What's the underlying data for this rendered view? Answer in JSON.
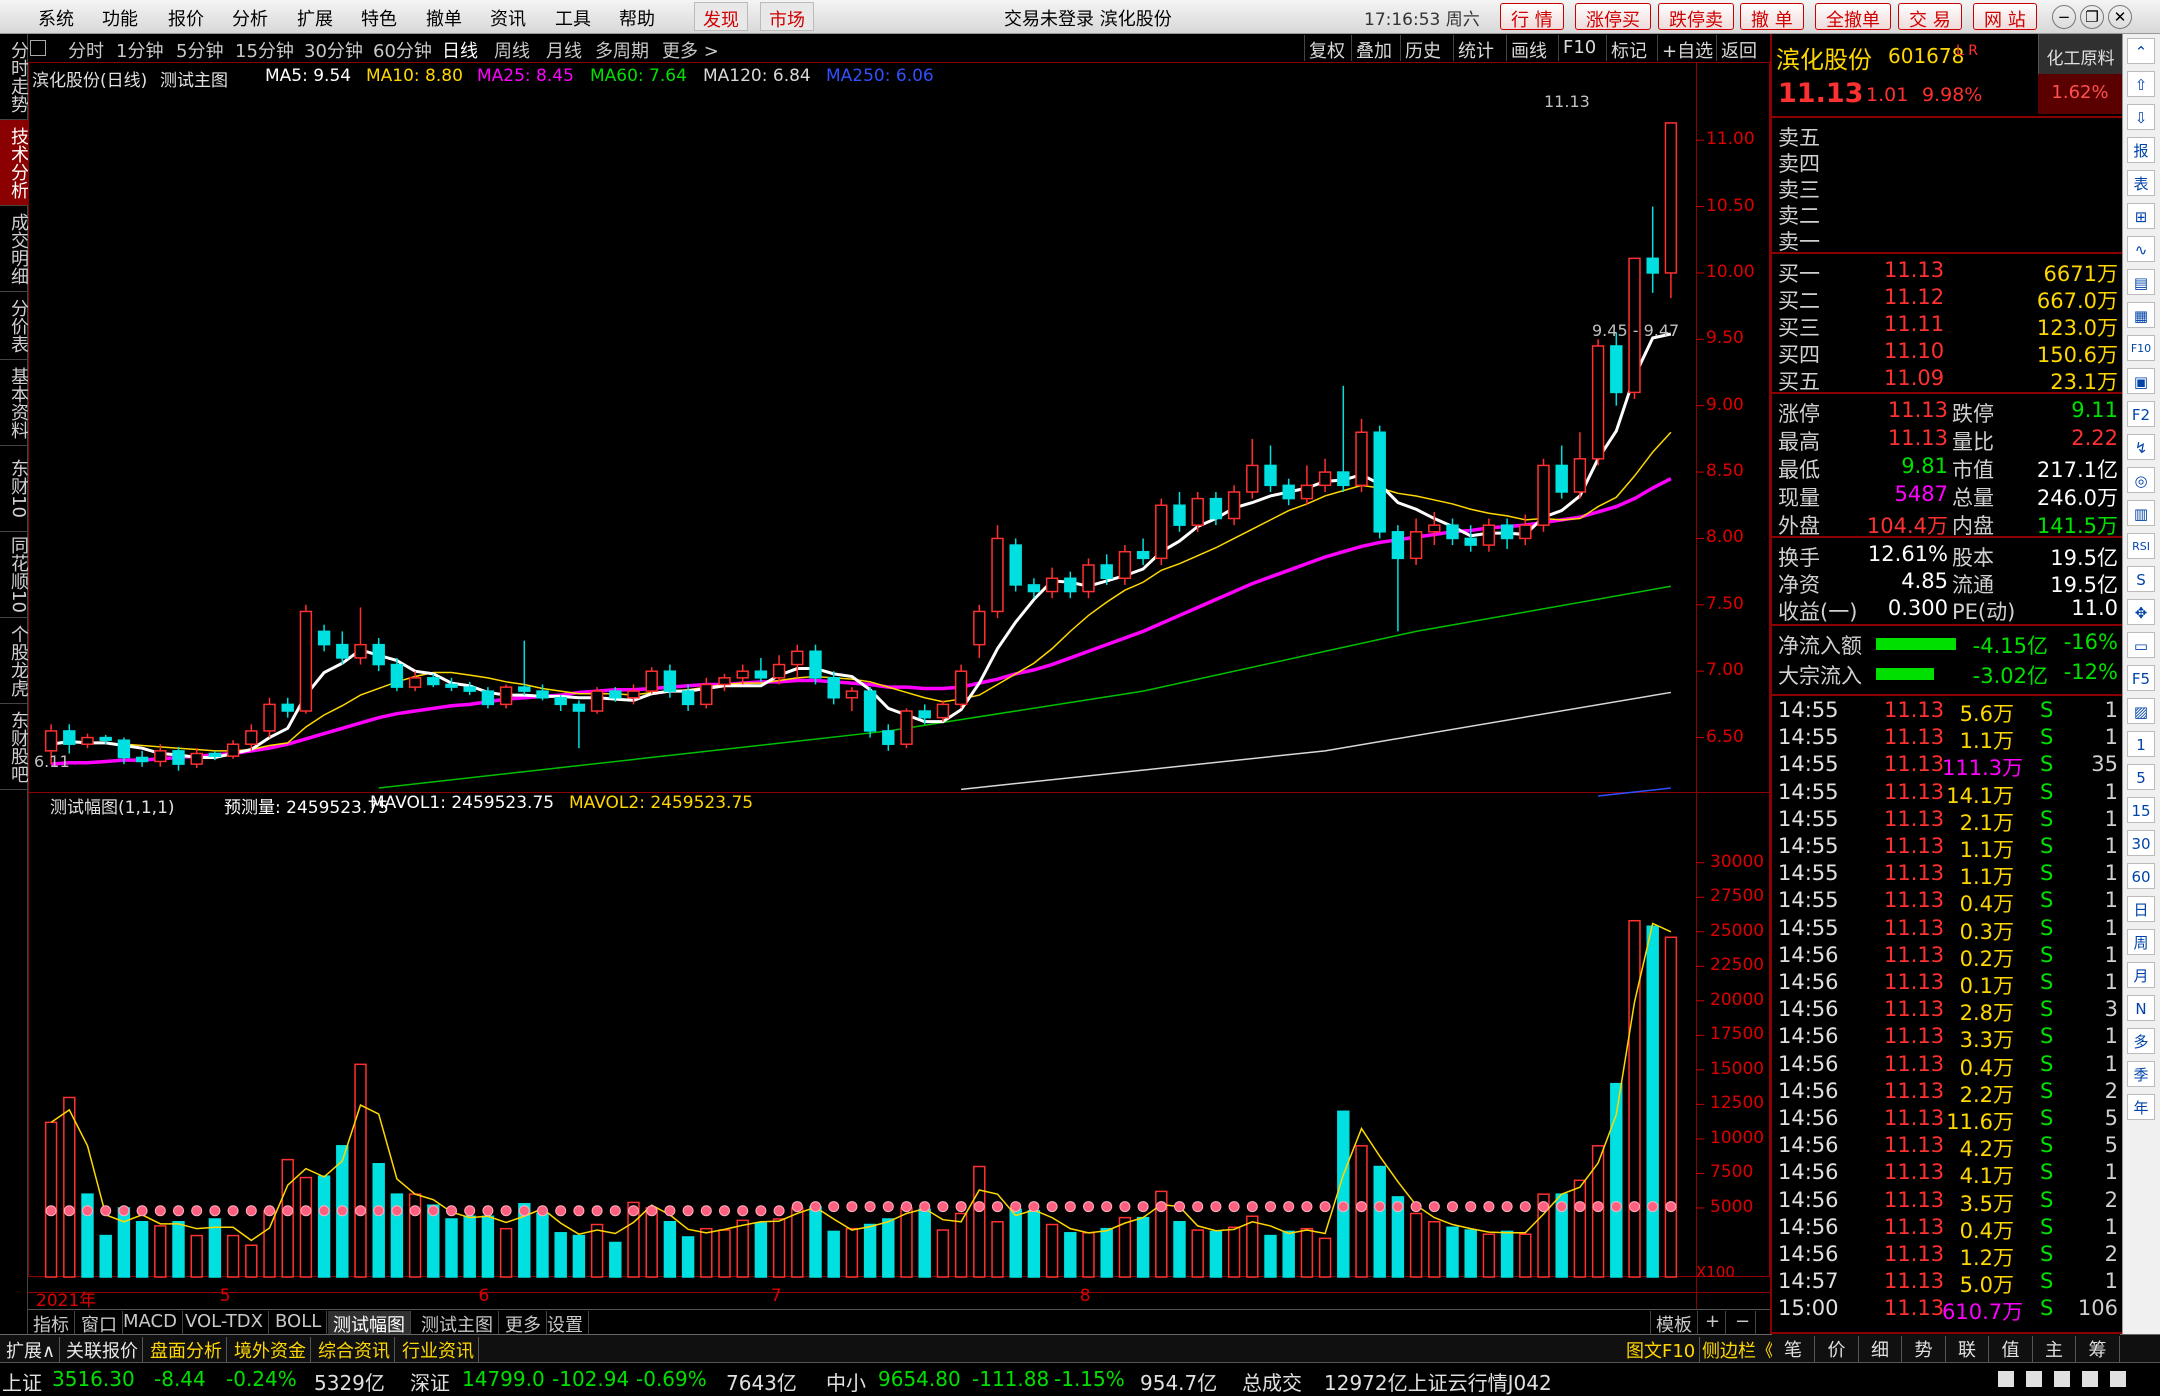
{
  "menu": {
    "items": [
      "系统",
      "功能",
      "报价",
      "分析",
      "扩展",
      "特色",
      "撤单",
      "资讯",
      "工具",
      "帮助"
    ],
    "highlight": [
      "发现",
      "市场"
    ],
    "title_text": "交易未登录  滨化股份",
    "clock": "17:16:53 周六",
    "quick_buttons": [
      "行 情",
      "涨停买",
      "跌停卖",
      "撤 单",
      "全撤单",
      "交 易",
      "网 站"
    ]
  },
  "left_tabs": [
    "分时走势",
    "技术分析",
    "成交明细",
    "分价表",
    "基本资料",
    "东财10",
    "同花顺10",
    "个股龙虎",
    "东财股吧"
  ],
  "left_tab_active": 1,
  "periods": [
    "分时",
    "1分钟",
    "5分钟",
    "15分钟",
    "30分钟",
    "60分钟",
    "日线",
    "周线",
    "月线",
    "多周期",
    "更多 >"
  ],
  "period_active": "日线",
  "chart_tools": [
    "复权",
    "叠加",
    "历史",
    "统计",
    "画线",
    "F10",
    "标记",
    "+自选",
    "返回"
  ],
  "main_indicator": {
    "title": "滨化股份(日线)",
    "formula": "测试主图",
    "ma5": "MA5: 9.54",
    "ma10": "MA10: 8.80",
    "ma25": "MA25: 8.45",
    "ma60": "MA60: 7.64",
    "ma120": "MA120: 6.84",
    "ma250": "MA250: 6.06"
  },
  "sub_indicator": {
    "title": "测试幅图(1,1,1)",
    "pred": "预测量: 2459523.75",
    "mavol1": "MAVOL1: 2459523.75",
    "mavol2": "MAVOL2: 2459523.75",
    "scale": "X100"
  },
  "chart_data": {
    "type": "candlestick",
    "price_axis": [
      "11.00",
      "10.50",
      "10.00",
      "9.50",
      "9.00",
      "8.50",
      "8.00",
      "7.50",
      "7.00",
      "6.50"
    ],
    "volume_axis": [
      "30000",
      "27500",
      "25000",
      "22500",
      "20000",
      "17500",
      "15000",
      "12500",
      "10000",
      "7500",
      "5000"
    ],
    "x_labels": [
      "2021年",
      "5",
      "6",
      "7",
      "8"
    ],
    "annot_high": "11.13",
    "annot_range": "9.45 - 9.47",
    "annot_low": "6.11",
    "candles": [
      [
        6.4,
        6.55,
        6.3,
        6.6
      ],
      [
        6.55,
        6.45,
        6.38,
        6.6
      ],
      [
        6.45,
        6.5,
        6.42,
        6.53
      ],
      [
        6.5,
        6.48,
        6.45,
        6.52
      ],
      [
        6.48,
        6.35,
        6.3,
        6.5
      ],
      [
        6.35,
        6.32,
        6.28,
        6.4
      ],
      [
        6.32,
        6.4,
        6.28,
        6.45
      ],
      [
        6.4,
        6.3,
        6.25,
        6.43
      ],
      [
        6.3,
        6.38,
        6.27,
        6.42
      ],
      [
        6.38,
        6.36,
        6.33,
        6.4
      ],
      [
        6.36,
        6.45,
        6.34,
        6.48
      ],
      [
        6.45,
        6.55,
        6.4,
        6.6
      ],
      [
        6.55,
        6.75,
        6.5,
        6.8
      ],
      [
        6.75,
        6.7,
        6.65,
        6.8
      ],
      [
        6.7,
        7.45,
        6.68,
        7.5
      ],
      [
        7.3,
        7.2,
        7.15,
        7.35
      ],
      [
        7.2,
        7.1,
        7.05,
        7.3
      ],
      [
        7.1,
        7.2,
        7.05,
        7.48
      ],
      [
        7.2,
        7.05,
        7.0,
        7.25
      ],
      [
        7.05,
        6.88,
        6.85,
        7.1
      ],
      [
        6.88,
        6.95,
        6.85,
        7.0
      ],
      [
        6.95,
        6.9,
        6.88,
        6.98
      ],
      [
        6.9,
        6.88,
        6.85,
        6.95
      ],
      [
        6.88,
        6.85,
        6.82,
        6.92
      ],
      [
        6.85,
        6.75,
        6.72,
        6.88
      ],
      [
        6.75,
        6.88,
        6.72,
        6.9
      ],
      [
        6.88,
        6.85,
        6.82,
        7.23
      ],
      [
        6.85,
        6.8,
        6.78,
        6.9
      ],
      [
        6.8,
        6.75,
        6.7,
        6.82
      ],
      [
        6.75,
        6.7,
        6.42,
        6.78
      ],
      [
        6.7,
        6.85,
        6.68,
        6.88
      ],
      [
        6.85,
        6.8,
        6.77,
        6.88
      ],
      [
        6.8,
        6.85,
        6.75,
        6.9
      ],
      [
        6.85,
        7.0,
        6.83,
        7.03
      ],
      [
        7.0,
        6.85,
        6.8,
        7.05
      ],
      [
        6.85,
        6.75,
        6.7,
        6.9
      ],
      [
        6.75,
        6.9,
        6.72,
        6.95
      ],
      [
        6.9,
        6.95,
        6.85,
        6.98
      ],
      [
        6.95,
        7.0,
        6.9,
        7.05
      ],
      [
        7.0,
        6.95,
        6.92,
        7.1
      ],
      [
        6.95,
        7.05,
        6.9,
        7.12
      ],
      [
        7.05,
        7.15,
        6.95,
        7.2
      ],
      [
        7.15,
        6.95,
        6.9,
        7.2
      ],
      [
        6.95,
        6.8,
        6.75,
        7.0
      ],
      [
        6.8,
        6.85,
        6.7,
        6.88
      ],
      [
        6.85,
        6.55,
        6.5,
        6.88
      ],
      [
        6.55,
        6.45,
        6.4,
        6.6
      ],
      [
        6.45,
        6.7,
        6.42,
        6.72
      ],
      [
        6.7,
        6.65,
        6.6,
        6.75
      ],
      [
        6.65,
        6.75,
        6.62,
        6.78
      ],
      [
        6.75,
        7.0,
        6.72,
        7.05
      ],
      [
        7.2,
        7.45,
        7.1,
        7.5
      ],
      [
        7.45,
        8.0,
        7.4,
        8.1
      ],
      [
        7.95,
        7.65,
        7.6,
        8.0
      ],
      [
        7.65,
        7.6,
        7.55,
        7.7
      ],
      [
        7.6,
        7.7,
        7.55,
        7.78
      ],
      [
        7.7,
        7.6,
        7.55,
        7.75
      ],
      [
        7.6,
        7.8,
        7.55,
        7.85
      ],
      [
        7.8,
        7.7,
        7.65,
        7.88
      ],
      [
        7.7,
        7.9,
        7.65,
        7.95
      ],
      [
        7.9,
        7.85,
        7.8,
        8.0
      ],
      [
        7.85,
        8.25,
        7.8,
        8.3
      ],
      [
        8.25,
        8.1,
        8.05,
        8.35
      ],
      [
        8.1,
        8.3,
        8.05,
        8.35
      ],
      [
        8.3,
        8.15,
        8.1,
        8.35
      ],
      [
        8.15,
        8.35,
        8.1,
        8.4
      ],
      [
        8.35,
        8.55,
        8.3,
        8.75
      ],
      [
        8.55,
        8.4,
        8.35,
        8.7
      ],
      [
        8.4,
        8.3,
        8.25,
        8.45
      ],
      [
        8.3,
        8.4,
        8.25,
        8.55
      ],
      [
        8.4,
        8.5,
        8.35,
        8.6
      ],
      [
        8.5,
        8.4,
        8.35,
        9.15
      ],
      [
        8.4,
        8.8,
        8.35,
        8.9
      ],
      [
        8.8,
        8.05,
        8.0,
        8.85
      ],
      [
        8.05,
        7.85,
        7.3,
        8.1
      ],
      [
        7.85,
        8.05,
        7.8,
        8.15
      ],
      [
        8.05,
        8.1,
        7.95,
        8.2
      ],
      [
        8.1,
        8.0,
        7.95,
        8.15
      ],
      [
        8.0,
        7.95,
        7.9,
        8.1
      ],
      [
        7.95,
        8.1,
        7.9,
        8.15
      ],
      [
        8.1,
        8.0,
        7.92,
        8.15
      ],
      [
        8.0,
        8.1,
        7.95,
        8.18
      ],
      [
        8.1,
        8.55,
        8.05,
        8.6
      ],
      [
        8.55,
        8.35,
        8.3,
        8.7
      ],
      [
        8.35,
        8.6,
        8.3,
        8.8
      ],
      [
        8.6,
        9.45,
        8.55,
        9.5
      ],
      [
        9.45,
        9.1,
        9.0,
        9.55
      ],
      [
        9.1,
        10.11,
        9.05,
        10.11
      ],
      [
        10.11,
        10.0,
        9.85,
        10.5
      ],
      [
        10.0,
        11.13,
        9.81,
        11.13
      ]
    ],
    "ma5": [
      6.45,
      6.47,
      6.46,
      6.46,
      6.44,
      6.42,
      6.38,
      6.37,
      6.35,
      6.35,
      6.38,
      6.41,
      6.5,
      6.57,
      6.82,
      6.99,
      7.06,
      7.16,
      7.12,
      7.08,
      7.0,
      6.98,
      6.91,
      6.89,
      6.84,
      6.82,
      6.82,
      6.81,
      6.81,
      6.8,
      6.8,
      6.79,
      6.78,
      6.83,
      6.85,
      6.85,
      6.87,
      6.89,
      6.89,
      6.89,
      6.97,
      7.02,
      7.02,
      6.98,
      6.96,
      6.86,
      6.72,
      6.67,
      6.62,
      6.62,
      6.71,
      6.91,
      7.17,
      7.37,
      7.54,
      7.68,
      7.67,
      7.64,
      7.68,
      7.72,
      7.77,
      7.9,
      7.98,
      8.09,
      8.15,
      8.23,
      8.27,
      8.32,
      8.35,
      8.38,
      8.43,
      8.44,
      8.48,
      8.41,
      8.27,
      8.22,
      8.15,
      8.09,
      8.02,
      8.04,
      8.04,
      8.03,
      8.16,
      8.21,
      8.32,
      8.6,
      8.81,
      9.22,
      9.51,
      9.54
    ],
    "ma10": [
      6.45,
      6.46,
      6.46,
      6.46,
      6.45,
      6.44,
      6.43,
      6.42,
      6.41,
      6.4,
      6.4,
      6.41,
      6.44,
      6.46,
      6.58,
      6.67,
      6.74,
      6.82,
      6.87,
      6.92,
      6.96,
      6.99,
      6.99,
      6.97,
      6.95,
      6.92,
      6.9,
      6.87,
      6.85,
      6.83,
      6.83,
      6.83,
      6.82,
      6.84,
      6.85,
      6.86,
      6.88,
      6.9,
      6.91,
      6.91,
      6.93,
      6.95,
      6.96,
      6.95,
      6.94,
      6.92,
      6.88,
      6.84,
      6.8,
      6.77,
      6.79,
      6.82,
      6.9,
      6.98,
      7.06,
      7.17,
      7.3,
      7.42,
      7.52,
      7.61,
      7.67,
      7.76,
      7.81,
      7.87,
      7.93,
      8.0,
      8.07,
      8.14,
      8.21,
      8.26,
      8.32,
      8.36,
      8.4,
      8.38,
      8.34,
      8.32,
      8.29,
      8.26,
      8.22,
      8.19,
      8.17,
      8.14,
      8.15,
      8.14,
      8.15,
      8.24,
      8.31,
      8.47,
      8.65,
      8.8
    ],
    "ma25": [
      6.3,
      6.31,
      6.31,
      6.32,
      6.33,
      6.33,
      6.34,
      6.35,
      6.36,
      6.37,
      6.38,
      6.4,
      6.42,
      6.45,
      6.49,
      6.53,
      6.57,
      6.61,
      6.65,
      6.68,
      6.7,
      6.72,
      6.74,
      6.75,
      6.77,
      6.79,
      6.8,
      6.81,
      6.82,
      6.84,
      6.85,
      6.86,
      6.86,
      6.87,
      6.88,
      6.89,
      6.9,
      6.9,
      6.91,
      6.92,
      6.92,
      6.93,
      6.93,
      6.92,
      6.91,
      6.9,
      6.88,
      6.88,
      6.87,
      6.87,
      6.88,
      6.91,
      6.94,
      6.98,
      7.01,
      7.05,
      7.1,
      7.15,
      7.2,
      7.25,
      7.3,
      7.36,
      7.42,
      7.48,
      7.54,
      7.6,
      7.66,
      7.71,
      7.76,
      7.81,
      7.86,
      7.9,
      7.94,
      7.97,
      7.99,
      8.01,
      8.03,
      8.05,
      8.06,
      8.08,
      8.09,
      8.1,
      8.12,
      8.14,
      8.16,
      8.2,
      8.24,
      8.3,
      8.38,
      8.45
    ]
  },
  "quote": {
    "name": "滨化股份",
    "code": "601678",
    "flag": "L R",
    "sector": "化工原料",
    "sector_pct": "1.62%",
    "price": "11.13",
    "change": "1.01",
    "pct": "9.98%",
    "sell": [
      {
        "label": "卖五",
        "price": "",
        "vol": ""
      },
      {
        "label": "卖四",
        "price": "",
        "vol": ""
      },
      {
        "label": "卖三",
        "price": "",
        "vol": ""
      },
      {
        "label": "卖二",
        "price": "",
        "vol": ""
      },
      {
        "label": "卖一",
        "price": "",
        "vol": ""
      }
    ],
    "buy": [
      {
        "label": "买一",
        "price": "11.13",
        "vol": "6671万"
      },
      {
        "label": "买二",
        "price": "11.12",
        "vol": "667.0万"
      },
      {
        "label": "买三",
        "price": "11.11",
        "vol": "123.0万"
      },
      {
        "label": "买四",
        "price": "11.10",
        "vol": "150.6万"
      },
      {
        "label": "买五",
        "price": "11.09",
        "vol": "23.1万"
      }
    ],
    "stats": [
      {
        "l1": "涨停",
        "v1": "11.13",
        "l2": "跌停",
        "v2": "9.11",
        "c1": "red",
        "c2": "green"
      },
      {
        "l1": "最高",
        "v1": "11.13",
        "l2": "量比",
        "v2": "2.22",
        "c1": "red",
        "c2": "red"
      },
      {
        "l1": "最低",
        "v1": "9.81",
        "l2": "市值",
        "v2": "217.1亿",
        "c1": "green",
        "c2": "white"
      },
      {
        "l1": "现量",
        "v1": "5487",
        "l2": "总量",
        "v2": "246.0万",
        "c1": "magenta",
        "c2": "white"
      },
      {
        "l1": "外盘",
        "v1": "104.4万",
        "l2": "内盘",
        "v2": "141.5万",
        "c1": "red",
        "c2": "green"
      }
    ],
    "stats2": [
      {
        "l1": "换手",
        "v1": "12.61%",
        "l2": "股本",
        "v2": "19.5亿"
      },
      {
        "l1": "净资",
        "v1": "4.85",
        "l2": "流通",
        "v2": "19.5亿"
      },
      {
        "l1": "收益(一)",
        "v1": "0.300",
        "l2": "PE(动)",
        "v2": "11.0"
      }
    ],
    "flows": [
      {
        "label": "净流入额",
        "value": "-4.15亿",
        "pct": "-16%"
      },
      {
        "label": "大宗流入",
        "value": "-3.02亿",
        "pct": "-12%"
      }
    ],
    "ticks": [
      {
        "t": "14:55",
        "p": "11.13",
        "v": "5.6万",
        "s": "S",
        "n": "1"
      },
      {
        "t": "14:55",
        "p": "11.13",
        "v": "1.1万",
        "s": "S",
        "n": "1"
      },
      {
        "t": "14:55",
        "p": "11.13",
        "v": "111.3万",
        "s": "S",
        "n": "35"
      },
      {
        "t": "14:55",
        "p": "11.13",
        "v": "14.1万",
        "s": "S",
        "n": "1"
      },
      {
        "t": "14:55",
        "p": "11.13",
        "v": "2.1万",
        "s": "S",
        "n": "1"
      },
      {
        "t": "14:55",
        "p": "11.13",
        "v": "1.1万",
        "s": "S",
        "n": "1"
      },
      {
        "t": "14:55",
        "p": "11.13",
        "v": "1.1万",
        "s": "S",
        "n": "1"
      },
      {
        "t": "14:55",
        "p": "11.13",
        "v": "0.4万",
        "s": "S",
        "n": "1"
      },
      {
        "t": "14:55",
        "p": "11.13",
        "v": "0.3万",
        "s": "S",
        "n": "1"
      },
      {
        "t": "14:56",
        "p": "11.13",
        "v": "0.2万",
        "s": "S",
        "n": "1"
      },
      {
        "t": "14:56",
        "p": "11.13",
        "v": "0.1万",
        "s": "S",
        "n": "1"
      },
      {
        "t": "14:56",
        "p": "11.13",
        "v": "2.8万",
        "s": "S",
        "n": "3"
      },
      {
        "t": "14:56",
        "p": "11.13",
        "v": "3.3万",
        "s": "S",
        "n": "1"
      },
      {
        "t": "14:56",
        "p": "11.13",
        "v": "0.4万",
        "s": "S",
        "n": "1"
      },
      {
        "t": "14:56",
        "p": "11.13",
        "v": "2.2万",
        "s": "S",
        "n": "2"
      },
      {
        "t": "14:56",
        "p": "11.13",
        "v": "11.6万",
        "s": "S",
        "n": "5"
      },
      {
        "t": "14:56",
        "p": "11.13",
        "v": "4.2万",
        "s": "S",
        "n": "5"
      },
      {
        "t": "14:56",
        "p": "11.13",
        "v": "4.1万",
        "s": "S",
        "n": "1"
      },
      {
        "t": "14:56",
        "p": "11.13",
        "v": "3.5万",
        "s": "S",
        "n": "2"
      },
      {
        "t": "14:56",
        "p": "11.13",
        "v": "0.4万",
        "s": "S",
        "n": "1"
      },
      {
        "t": "14:56",
        "p": "11.13",
        "v": "1.2万",
        "s": "S",
        "n": "2"
      },
      {
        "t": "14:57",
        "p": "11.13",
        "v": "5.0万",
        "s": "S",
        "n": "1"
      },
      {
        "t": "15:00",
        "p": "11.13",
        "v": "610.7万",
        "s": "S",
        "n": "106"
      }
    ],
    "bottom_tabs": [
      "笔",
      "价",
      "细",
      "势",
      "联",
      "值",
      "主",
      "筹"
    ]
  },
  "volume": [
    11200,
    13000,
    6000,
    3000,
    5000,
    4000,
    3700,
    4000,
    3000,
    4200,
    3000,
    2300,
    4800,
    8500,
    7200,
    7300,
    9500,
    15400,
    8200,
    6000,
    6000,
    5200,
    4200,
    4400,
    4400,
    3500,
    5300,
    4600,
    3200,
    3000,
    3800,
    2500,
    5400,
    5000,
    4000,
    2900,
    3500,
    3400,
    4100,
    3900,
    4200,
    5000,
    5100,
    3300,
    3500,
    3800,
    4200,
    5000,
    4900,
    3400,
    4600,
    8000,
    4000,
    4900,
    4800,
    3800,
    3200,
    3200,
    3500,
    4300,
    4300,
    6200,
    4000,
    3400,
    3300,
    3600,
    4400,
    3000,
    3300,
    3500,
    2800,
    12000,
    9500,
    8000,
    5800,
    4600,
    4000,
    3600,
    3400,
    3100,
    3300,
    3100,
    6000,
    6000,
    7000,
    9500,
    14000,
    25800,
    25400,
    24600
  ],
  "vol_up": [
    1,
    1,
    0,
    0,
    0,
    0,
    1,
    0,
    1,
    0,
    1,
    1,
    1,
    1,
    1,
    0,
    0,
    1,
    0,
    0,
    1,
    0,
    0,
    0,
    0,
    1,
    0,
    0,
    0,
    0,
    1,
    0,
    1,
    1,
    0,
    0,
    1,
    1,
    1,
    0,
    1,
    1,
    0,
    0,
    1,
    0,
    0,
    1,
    0,
    1,
    1,
    1,
    1,
    0,
    0,
    1,
    0,
    1,
    0,
    1,
    0,
    1,
    0,
    1,
    0,
    1,
    1,
    0,
    0,
    1,
    1,
    0,
    1,
    0,
    0,
    1,
    1,
    0,
    0,
    1,
    0,
    1,
    1,
    0,
    1,
    1,
    0,
    1,
    0,
    1
  ],
  "bottom_tabs": [
    "指标",
    "窗口",
    "MACD",
    "VOL-TDX",
    "BOLL",
    "测试幅图",
    "测试主图",
    "更多",
    "设置"
  ],
  "bottom_tab_active": "测试幅图",
  "bottom_right": [
    "模板",
    "+",
    "−"
  ],
  "info_tabs": [
    "扩展∧",
    "关联报价",
    "盘面分析",
    "境外资金",
    "综合资讯",
    "行业资讯"
  ],
  "info_right": [
    "图文F10",
    "侧边栏《"
  ],
  "status": {
    "sh_name": "上证",
    "sh_val": "3516.30",
    "sh_chg": "-8.44",
    "sh_pct": "-0.24%",
    "sh_amt": "5329亿",
    "sz_name": "深证",
    "sz_val": "14799.0",
    "sz_chg": "-102.94",
    "sz_pct": "-0.69%",
    "sz_amt": "7643亿",
    "zx_name": "中小",
    "zx_val": "9654.80",
    "zx_chg": "-111.88",
    "zx_pct": "-1.15%",
    "zx_amt": "954.7亿",
    "total": "总成交",
    "total_val": "12972亿上证云行情J042"
  },
  "right_tools": [
    "⌃",
    "⇧",
    "⇩",
    "报",
    "表",
    "⊞",
    "∿",
    "▤",
    "▦",
    "F10",
    "▣",
    "F2",
    "↯",
    "◎",
    "▥",
    "RSI",
    "S",
    "✥",
    "▭",
    "F5",
    "▨",
    "1",
    "5",
    "15",
    "30",
    "60",
    "日",
    "周",
    "月",
    "N",
    "多",
    "季",
    "年"
  ]
}
